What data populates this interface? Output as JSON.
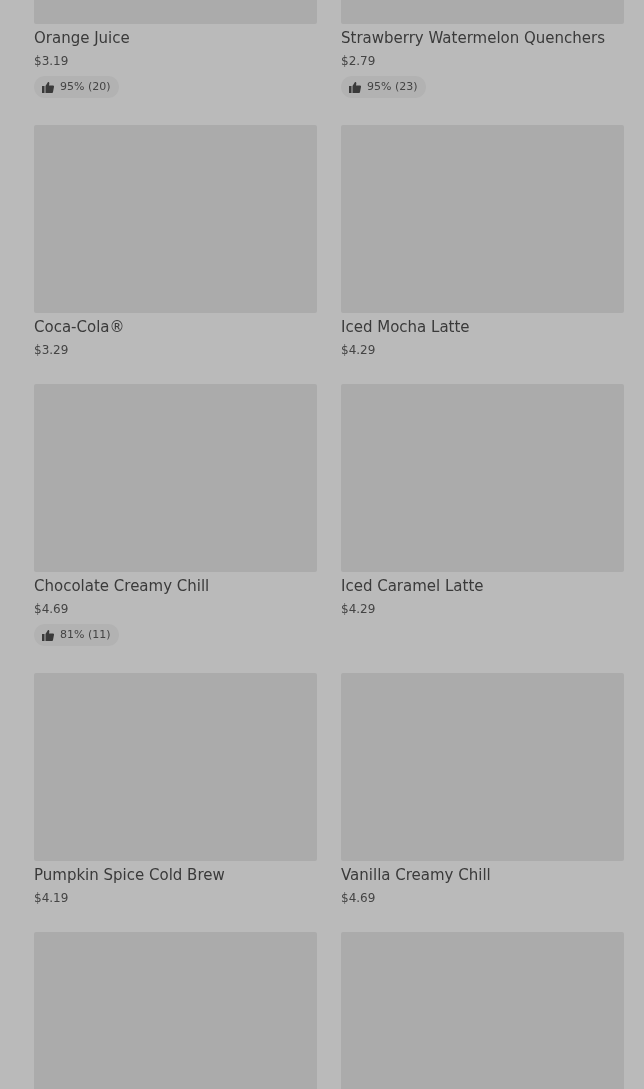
{
  "items": [
    {
      "kind": "product",
      "name": "Orange Juice",
      "price": "$3.19",
      "rating": "95% (20)"
    },
    {
      "kind": "product",
      "name": "Strawberry Watermelon Quenchers",
      "price": "$2.79",
      "rating": "95% (23)"
    },
    {
      "kind": "product",
      "name": "Coca-Cola®",
      "price": "$3.29"
    },
    {
      "kind": "product",
      "name": "Iced Mocha Latte",
      "price": "$4.29"
    },
    {
      "kind": "product",
      "name": "Chocolate Creamy Chill",
      "price": "$4.69",
      "rating": "81% (11)"
    },
    {
      "kind": "product",
      "name": "Iced Caramel Latte",
      "price": "$4.29"
    },
    {
      "kind": "product",
      "name": "Pumpkin Spice Cold Brew",
      "price": "$4.19"
    },
    {
      "kind": "product",
      "name": "Vanilla Creamy Chill",
      "price": "$4.69"
    },
    {
      "kind": "image"
    },
    {
      "kind": "image"
    }
  ]
}
